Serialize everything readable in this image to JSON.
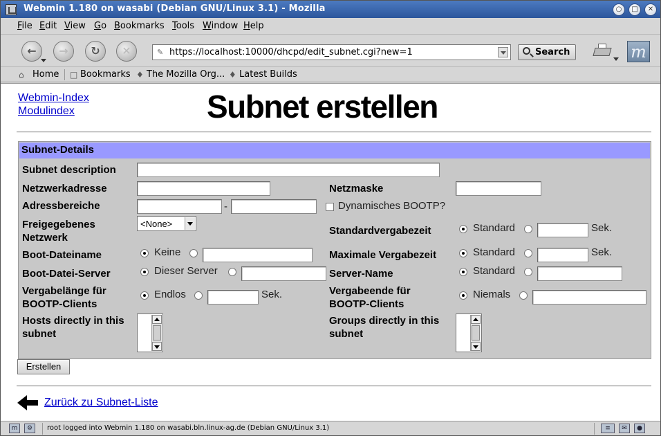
{
  "window": {
    "title": "Webmin 1.180 on wasabi (Debian GNU/Linux 3.1) - Mozilla",
    "buttons": [
      "○",
      "□",
      "✕"
    ]
  },
  "menu": [
    "File",
    "Edit",
    "View",
    "Go",
    "Bookmarks",
    "Tools",
    "Window",
    "Help"
  ],
  "nav": {
    "url": "https://localhost:10000/dhcpd/edit_subnet.cgi?new=1",
    "search_label": "Search",
    "back_glyph": "←",
    "forward_glyph": "→",
    "reload_glyph": "↻",
    "stop_glyph": "✕",
    "throbber_glyph": "m"
  },
  "bookmarks": {
    "home": "Home",
    "bookmarks": "Bookmarks",
    "mozilla": "The Mozilla Org...",
    "latest": "Latest Builds"
  },
  "page": {
    "webmin_index": "Webmin-Index",
    "module_index": "Modulindex",
    "title": "Subnet erstellen",
    "section_header": "Subnet-Details",
    "submit_label": "Erstellen",
    "back_link": "Zurück zu Subnet-Liste"
  },
  "form": {
    "subnet_description": "Subnet description",
    "network_address": "Netzwerkadresse",
    "netmask": "Netzmaske",
    "address_ranges": "Adressbereiche",
    "range_separator": "-",
    "dynamic_bootp": "Dynamisches BOOTP?",
    "shared_network_line1": "Freigegebenes",
    "shared_network_line2": "Netzwerk",
    "shared_network_value": "<None>",
    "default_lease": "Standardvergabezeit",
    "standard": "Standard",
    "seconds": "Sek.",
    "boot_filename": "Boot-Dateiname",
    "none": "Keine",
    "max_lease": "Maximale Vergabezeit",
    "boot_file_server": "Boot-Datei-Server",
    "this_server": "Dieser Server",
    "server_name": "Server-Name",
    "bootp_length_line1": "Vergabelänge für",
    "bootp_length_line2": "BOOTP-Clients",
    "forever": "Endlos",
    "bootp_end_line1": "Vergabeende für",
    "bootp_end_line2": "BOOTP-Clients",
    "never": "Niemals",
    "hosts_line1": "Hosts directly in this",
    "hosts_line2": "subnet",
    "groups_line1": "Groups directly in this",
    "groups_line2": "subnet"
  },
  "status": {
    "text": "root logged into Webmin 1.180 on wasabi.bln.linux-ag.de (Debian GNU/Linux 3.1)"
  }
}
